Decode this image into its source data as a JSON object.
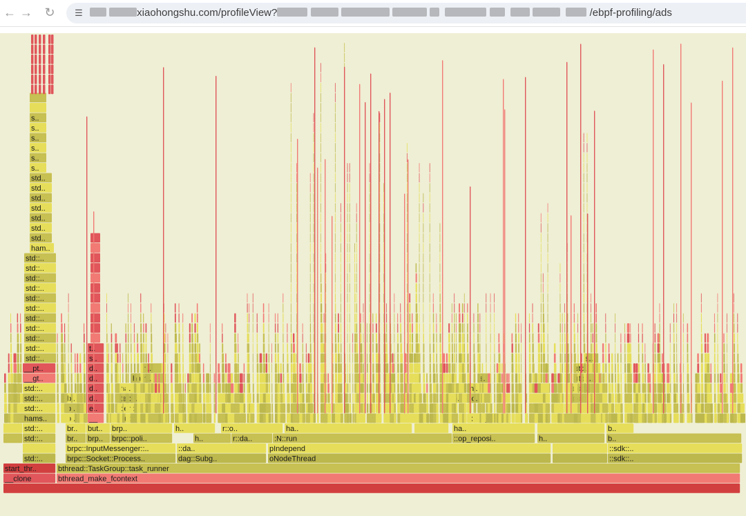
{
  "browser": {
    "back_icon": "arrow-left-icon",
    "forward_icon": "arrow-right-icon",
    "reload_icon": "reload-icon",
    "site_info_icon": "tune-icon",
    "url_visible_1": "xiaohongshu.com/profileView?",
    "url_visible_2": "/ebpf-profiling/ads"
  },
  "flamegraph": {
    "palette": {
      "red": "#e0565a",
      "deep_red": "#d23f3f",
      "light_red": "#f27a74",
      "olive": "#c7c052",
      "yellow": "#e6de5a",
      "khaki": "#bdb84d",
      "background": "#efefd5"
    },
    "labels": {
      "root_bar": "",
      "l1_a": "__clone",
      "l1_b": "bthread_make_fcontext",
      "l2_a": "start_thr..",
      "l2_b": "bthread::TaskGroup::task_runner",
      "l3_a": "std::..",
      "l3_b": "brpc::Socket::Process..",
      "l3_c": "dag::Subg..",
      "l3_d": "oNodeThread",
      "l3_e": "::sdk::..",
      "l4_a": "brpc::InputMessenger::..",
      "l4_b": "h",
      "l4_c": "::da..",
      "l4_d": "pIndepend",
      "l4_e": "::sdk::..",
      "l5_a": "std::..",
      "l5_b": "br..",
      "l5_c": "brp..",
      "l5_d": "brpc::poli..",
      "l5_e": "h..",
      "l5_f": "r::da..",
      "l5_g": ":N::run",
      "l5_h": "::op_reposi..",
      "l5_i": "h..",
      "l5_j": "b..",
      "l6_a": "std::..",
      "l6_b": "br..",
      "l6_c": "but..",
      "l6_d": "brp..",
      "l6_e": "brpc::poli..",
      "l6_f": "h..",
      "l6_g": "r::o..",
      "l6_h": "ha..",
      "l6_i": "b..",
      "l7_a": "hams..",
      "l7_b": "b..",
      "l7_c": "__",
      "l7_d": "er::..",
      "l7_e": "h..",
      "l7_f": "h..",
      "l7_g": "h..",
      "l7_h": ":op_r..",
      "l7_i": "z..",
      "l7_j": "std::..",
      "l8_a": "std::..",
      "l8_b": "b..",
      "l8_c": "e..",
      "l8_d": "cer::..",
      "l8_e": "b..",
      "l8_f": "z..",
      "l8_g": "std::..",
      "l9_a": "std::..",
      "l9_b": "b..",
      "l9_c": "d..",
      "l9_d": "h",
      "l9_e": "ter::..",
      "l9_f": "bo..",
      "l9_g": "lo..",
      "l9_h": "z..",
      "l9_i": "std::..",
      "l10_a": "std::..",
      "l10_b": "std::..",
      "l10_c": "d..",
      "l10_d": "ha..",
      "l10_e": "h..",
      "l10_f": "b..",
      "l10_g": "ni..",
      "l10_h": "z..",
      "l10_i": "std::..",
      "l11_a": "__gt..",
      "l11_b": "d..",
      "l11_c": "ham..",
      "l11_d": "s..",
      "l11_e": "std::..",
      "l12_a": "__pt..",
      "l12_b": "d..",
      "l12_c": "h..",
      "l12_d": "std..",
      "l13_a": "std::..",
      "l13_b": "s..",
      "l13_c": "s..",
      "l14_a": "std::..",
      "l14_b": "t..",
      "tower_std": "std::..",
      "tower_ham": "ham..",
      "tower_std_short": "std..",
      "tower_s": "s.."
    }
  }
}
